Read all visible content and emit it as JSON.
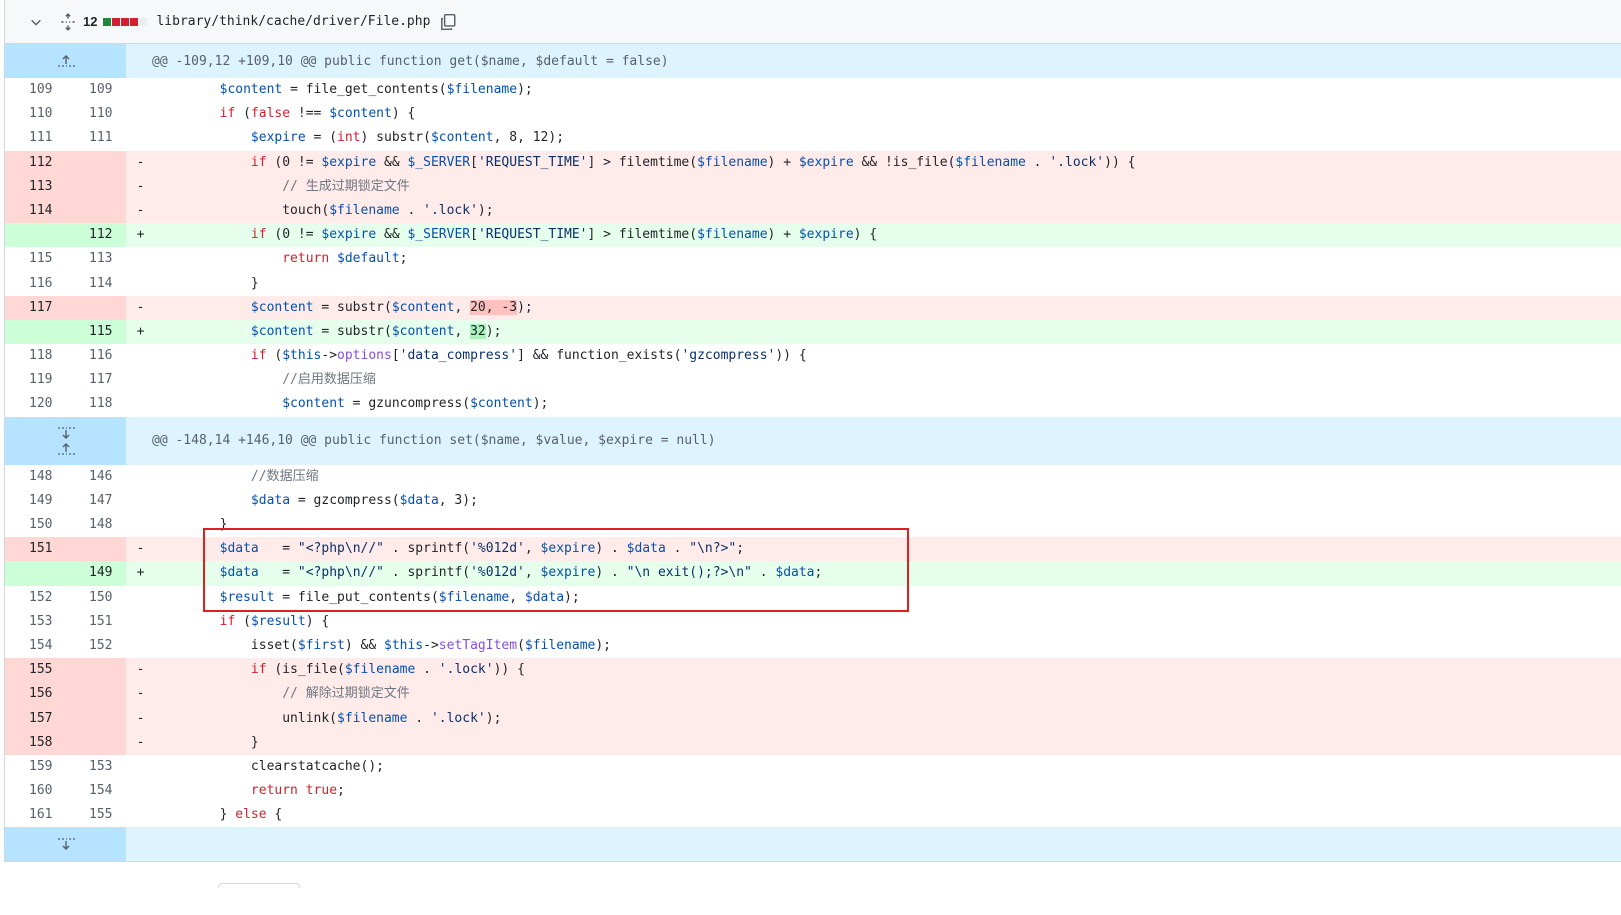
{
  "file": {
    "change_count": "12",
    "path": "library/think/cache/driver/File.php",
    "stat_colors": [
      "#1f883d",
      "#cf222e",
      "#cf222e",
      "#cf222e",
      "#eaeef2"
    ]
  },
  "hunks": [
    "@@ -109,12 +109,10 @@ public function get($name, $default = false)",
    "@@ -148,14 +146,10 @@ public function set($name, $value, $expire = null)"
  ],
  "lines_a": [
    {
      "t": "ctx",
      "o": "109",
      "n": "109",
      "s": "",
      "c": "        $content = file_get_contents($filename);"
    },
    {
      "t": "ctx",
      "o": "110",
      "n": "110",
      "s": "",
      "c": "        if (false !== $content) {"
    },
    {
      "t": "ctx",
      "o": "111",
      "n": "111",
      "s": "",
      "c": "            $expire = (int) substr($content, 8, 12);"
    },
    {
      "t": "del",
      "o": "112",
      "n": "",
      "s": "-",
      "c": "            if (0 != $expire && $_SERVER['REQUEST_TIME'] > filemtime($filename) + $expire && !is_file($filename . '.lock')) {"
    },
    {
      "t": "del",
      "o": "113",
      "n": "",
      "s": "-",
      "c": "                // 生成过期锁定文件"
    },
    {
      "t": "del",
      "o": "114",
      "n": "",
      "s": "-",
      "c": "                touch($filename . '.lock');"
    },
    {
      "t": "add",
      "o": "",
      "n": "112",
      "s": "+",
      "c": "            if (0 != $expire && $_SERVER['REQUEST_TIME'] > filemtime($filename) + $expire) {"
    },
    {
      "t": "ctx",
      "o": "115",
      "n": "113",
      "s": "",
      "c": "                return $default;"
    },
    {
      "t": "ctx",
      "o": "116",
      "n": "114",
      "s": "",
      "c": "            }"
    },
    {
      "t": "del",
      "o": "117",
      "n": "",
      "s": "-",
      "c": "            $content = substr($content, 20, -3);"
    },
    {
      "t": "add",
      "o": "",
      "n": "115",
      "s": "+",
      "c": "            $content = substr($content, 32);"
    },
    {
      "t": "ctx",
      "o": "118",
      "n": "116",
      "s": "",
      "c": "            if ($this->options['data_compress'] && function_exists('gzcompress')) {"
    },
    {
      "t": "ctx",
      "o": "119",
      "n": "117",
      "s": "",
      "c": "                //启用数据压缩"
    },
    {
      "t": "ctx",
      "o": "120",
      "n": "118",
      "s": "",
      "c": "                $content = gzuncompress($content);"
    }
  ],
  "lines_b": [
    {
      "t": "ctx",
      "o": "148",
      "n": "146",
      "s": "",
      "c": "            //数据压缩"
    },
    {
      "t": "ctx",
      "o": "149",
      "n": "147",
      "s": "",
      "c": "            $data = gzcompress($data, 3);"
    },
    {
      "t": "ctx",
      "o": "150",
      "n": "148",
      "s": "",
      "c": "        }"
    },
    {
      "t": "del",
      "o": "151",
      "n": "",
      "s": "-",
      "c": "        $data   = \"<?php\\n//\" . sprintf('%012d', $expire) . $data . \"\\n?>\";"
    },
    {
      "t": "add",
      "o": "",
      "n": "149",
      "s": "+",
      "c": "        $data   = \"<?php\\n//\" . sprintf('%012d', $expire) . \"\\n exit();?>\\n\" . $data;"
    },
    {
      "t": "ctx",
      "o": "152",
      "n": "150",
      "s": "",
      "c": "        $result = file_put_contents($filename, $data);"
    },
    {
      "t": "ctx",
      "o": "153",
      "n": "151",
      "s": "",
      "c": "        if ($result) {"
    },
    {
      "t": "ctx",
      "o": "154",
      "n": "152",
      "s": "",
      "c": "            isset($first) && $this->setTagItem($filename);"
    },
    {
      "t": "del",
      "o": "155",
      "n": "",
      "s": "-",
      "c": "            if (is_file($filename . '.lock')) {"
    },
    {
      "t": "del",
      "o": "156",
      "n": "",
      "s": "-",
      "c": "                // 解除过期锁定文件"
    },
    {
      "t": "del",
      "o": "157",
      "n": "",
      "s": "-",
      "c": "                unlink($filename . '.lock');"
    },
    {
      "t": "del",
      "o": "158",
      "n": "",
      "s": "-",
      "c": "            }"
    },
    {
      "t": "ctx",
      "o": "159",
      "n": "153",
      "s": "",
      "c": "            clearstatcache();"
    },
    {
      "t": "ctx",
      "o": "160",
      "n": "154",
      "s": "",
      "c": "            return true;"
    },
    {
      "t": "ctx",
      "o": "161",
      "n": "155",
      "s": "",
      "c": "        } else {"
    }
  ]
}
